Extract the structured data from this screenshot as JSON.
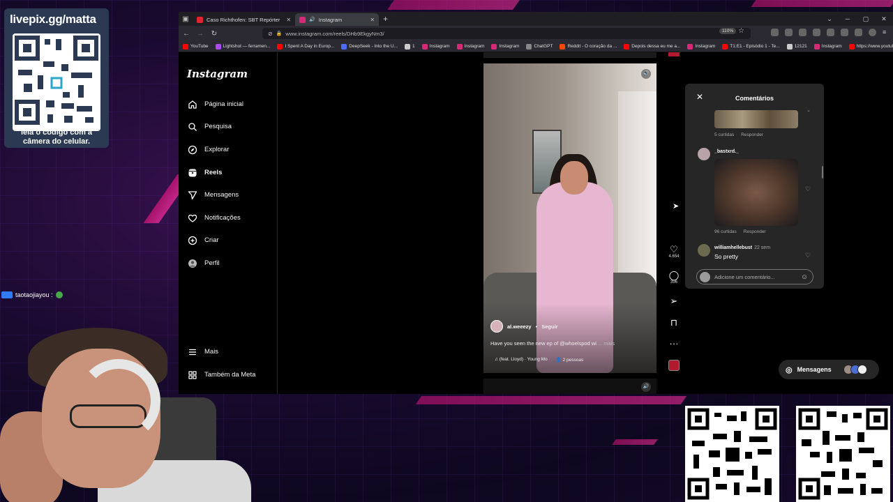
{
  "overlay": {
    "qr_url": "livepix.gg/matta",
    "qr_caption": "leia o código com a câmera do celular.",
    "chat_user": "taotaojiayou :"
  },
  "browser": {
    "tabs": [
      {
        "label": "Caso Richthofen: SBT Repórter",
        "active": false,
        "color": "#e0242b"
      },
      {
        "label": "Instagram",
        "active": true,
        "color": "#d62976"
      }
    ],
    "url": "www.instagram.com/reels/DHb9EkgyNm3/",
    "zoom": "110%",
    "bookmarks": [
      {
        "label": "YouTube",
        "color": "#ff0000"
      },
      {
        "label": "Lightshot — ferramen...",
        "color": "#a84cf0"
      },
      {
        "label": "I Spent A Day in Europ...",
        "color": "#ff0000"
      },
      {
        "label": "DeepSeek - Into the U...",
        "color": "#4d6bfe"
      },
      {
        "label": "1",
        "color": "#cccccc"
      },
      {
        "label": "Instagram",
        "color": "#d62976"
      },
      {
        "label": "Instagram",
        "color": "#d62976"
      },
      {
        "label": "Instagram",
        "color": "#d62976"
      },
      {
        "label": "ChatGPT",
        "color": "#888888"
      },
      {
        "label": "Reddit - O coração da ...",
        "color": "#ff4500"
      },
      {
        "label": "Depois dessa eu me a...",
        "color": "#ff0000"
      },
      {
        "label": "Instagram",
        "color": "#d62976"
      },
      {
        "label": "T1:E1 - Episódio 1 - Te...",
        "color": "#ff0000"
      },
      {
        "label": "12121",
        "color": "#cccccc"
      },
      {
        "label": "Instagram",
        "color": "#d62976"
      },
      {
        "label": "https://www.youtube....",
        "color": "#ff0000"
      }
    ]
  },
  "instagram": {
    "logo": "Instagram",
    "nav": [
      {
        "label": "Página inicial",
        "icon": "home-icon",
        "bold": false
      },
      {
        "label": "Pesquisa",
        "icon": "search-icon",
        "bold": false
      },
      {
        "label": "Explorar",
        "icon": "compass-icon",
        "bold": false
      },
      {
        "label": "Reels",
        "icon": "reels-icon",
        "bold": true
      },
      {
        "label": "Mensagens",
        "icon": "send-icon",
        "bold": false
      },
      {
        "label": "Notificações",
        "icon": "heart-icon",
        "bold": false
      },
      {
        "label": "Criar",
        "icon": "plus-icon",
        "bold": false
      },
      {
        "label": "Perfil",
        "icon": "profile-icon",
        "bold": false
      }
    ],
    "nav_bottom": [
      {
        "label": "Mais",
        "icon": "menu-icon"
      },
      {
        "label": "Também da Meta",
        "icon": "meta-icon"
      }
    ],
    "reel": {
      "username": "al.weeezy",
      "separator": "•",
      "follow": "Seguir",
      "caption": "Have you seen the new ep of @whoelspod wi",
      "caption_more": "... mais",
      "audio": "(feat. Lloyd) · Young Mo",
      "people": "2 pessoas"
    },
    "actions": {
      "likes": "4.654",
      "comments": "396"
    },
    "comments_panel": {
      "title": "Comentários",
      "comment1_meta": {
        "likes": "5 curtidas",
        "reply": "Responder"
      },
      "comment2": {
        "user": "_bastxrd._",
        "likes": "96 curtidas",
        "reply": "Responder"
      },
      "comment3": {
        "user": "williamhellebust",
        "time": "22 sem",
        "text": "So pretty"
      },
      "input_placeholder": "Adicione um comentário..."
    },
    "messages_button": "Mensagens"
  }
}
